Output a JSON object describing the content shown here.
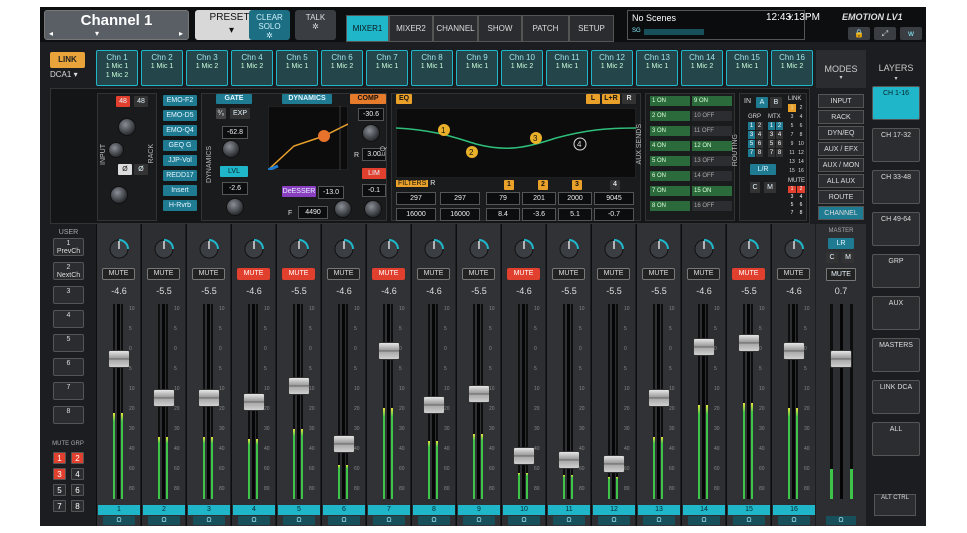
{
  "topbar": {
    "channel_title": "Channel 1",
    "prev_arrow": "◂",
    "next_arrow": "▸",
    "channel_menu": "▾",
    "preset_label": "PRESET*",
    "preset_menu": "▾",
    "clear_solo_label": "CLEAR SOLO",
    "talk_label": "TALK",
    "gear": "✲",
    "tabs": [
      "MIXER1",
      "MIXER2",
      "CHANNEL",
      "SHOW",
      "PATCH",
      "SETUP"
    ],
    "scenes_label": "No Scenes",
    "scenes_level": "SG",
    "time": "12:43:13PM",
    "logo": "EMOTION LV1",
    "icons": [
      "lock-icon",
      "fullscreen-icon",
      "waves-icon"
    ]
  },
  "link": {
    "label": "LINK",
    "dca_label": "DCA1 ▾"
  },
  "channels": [
    {
      "name": "Chn 1",
      "src": "1 Mic 1",
      "src2": "1 Mic 2"
    },
    {
      "name": "Chn 2",
      "src": "1 Mic 1"
    },
    {
      "name": "Chn 3",
      "src": "1 Mic 2"
    },
    {
      "name": "Chn 4",
      "src": "1 Mic 2"
    },
    {
      "name": "Chn 5",
      "src": "1 Mic 1"
    },
    {
      "name": "Chn 6",
      "src": "1 Mic 2"
    },
    {
      "name": "Chn 7",
      "src": "1 Mic 1"
    },
    {
      "name": "Chn 8",
      "src": "1 Mic 1"
    },
    {
      "name": "Chn 9",
      "src": "1 Mic 1"
    },
    {
      "name": "Chn 10",
      "src": "1 Mic 2"
    },
    {
      "name": "Chn 11",
      "src": "1 Mic 1"
    },
    {
      "name": "Chn 12",
      "src": "1 Mic 2"
    },
    {
      "name": "Chn 13",
      "src": "1 Mic 1"
    },
    {
      "name": "Chn 14",
      "src": "1 Mic 2"
    },
    {
      "name": "Chn 15",
      "src": "1 Mic 1"
    },
    {
      "name": "Chn 16",
      "src": "1 Mic 2"
    }
  ],
  "modes": {
    "label": "MODES",
    "arrow": "▾"
  },
  "layers": {
    "label": "LAYERS",
    "arrow": "▾",
    "items": [
      "CH 1-16",
      "CH 17-32",
      "CH 33-48",
      "CH 49-64",
      "GRP",
      "AUX",
      "MASTERS",
      "LINK DCA",
      "ALL"
    ],
    "alt_ctrl": "ALT CTRL"
  },
  "editor": {
    "input_label": "INPUT",
    "rack_label": "RACK",
    "phantom": "48",
    "phase": "Ø",
    "rack_items": [
      "EMO-F2",
      "EMO-D5",
      "EMO-Q4",
      "GEQ G",
      "JJP-Vol",
      "REDD17",
      "Insert",
      "H-Rvrb"
    ],
    "dynamics_label": "DYNAMICS",
    "gate_label": "GATE",
    "dynamics_head": "DYNAMICS",
    "comp_label": "COMP",
    "exp_label": "EXP",
    "gate_thresh": "-62.8",
    "lvl_label": "LVL",
    "lvl_value": "-2.6",
    "deesser_label": "DeESSER",
    "deesser_value": "-13.0",
    "deesser_f_label": "F",
    "deesser_freq": "4490",
    "comp_thresh": "-30.6",
    "comp_r_label": "R",
    "comp_ratio": "3.00",
    "lim_label": "LIM",
    "lim_value": "-0.1",
    "eq_label": "EQ",
    "eq_section_label": "EQ",
    "eq_l": "L",
    "eq_lr": "L+R",
    "eq_r": "R",
    "eq_bands": [
      "1",
      "2",
      "3",
      "4"
    ],
    "filters_label": "FILTERS",
    "filters_r": "R",
    "filter_vals": [
      "297",
      "297"
    ],
    "filter_vals2": [
      "16000",
      "16000"
    ],
    "eq_freqs": [
      "79",
      "201",
      "2000",
      "9045"
    ],
    "eq_gains": [
      "8.4",
      "-3.6",
      "5.1",
      "-0.7"
    ],
    "aux_label": "AUX SENDS",
    "aux_left": [
      "1 ON",
      "2 ON",
      "3 ON",
      "4 ON",
      "5 ON",
      "6 ON",
      "7 ON",
      "8 ON"
    ],
    "aux_right": [
      "9 ON",
      "10 OFF",
      "11 OFF",
      "12 ON",
      "13 OFF",
      "14 OFF",
      "15 ON",
      "16 OFF"
    ],
    "routing_label": "ROUTING",
    "routing_in": "IN",
    "routing_a": "A",
    "routing_b": "B",
    "grp_label": "GRP",
    "mtx_label": "MTX",
    "grp_nums": [
      "1",
      "2",
      "3",
      "4",
      "5",
      "6",
      "7",
      "8"
    ],
    "mtx_nums": [
      "1",
      "2",
      "3",
      "4",
      "5",
      "6",
      "7",
      "8"
    ],
    "lr_label": "L/R",
    "c_label": "C",
    "m_label": "M",
    "link_label": "LINK",
    "link_nums": [
      "1",
      "2",
      "3",
      "4",
      "5",
      "6",
      "7",
      "8",
      "9",
      "10",
      "11",
      "12",
      "13",
      "14",
      "15",
      "16"
    ],
    "mute_label": "MUTE",
    "mute_nums": [
      "1",
      "2",
      "3",
      "4",
      "5",
      "6",
      "7",
      "8"
    ]
  },
  "mode_buttons": [
    "INPUT",
    "RACK",
    "DYN/EQ",
    "AUX / EFX",
    "AUX / MON",
    "ALL AUX",
    "ROUTE",
    "CHANNEL"
  ],
  "user": {
    "label": "USER",
    "buttons": [
      {
        "n": "1",
        "t": "PrevCh"
      },
      {
        "n": "2",
        "t": "NextCh"
      },
      {
        "n": "3",
        "t": ""
      },
      {
        "n": "4",
        "t": ""
      },
      {
        "n": "5",
        "t": ""
      },
      {
        "n": "6",
        "t": ""
      },
      {
        "n": "7",
        "t": ""
      },
      {
        "n": "8",
        "t": ""
      }
    ],
    "mute_grp_label": "MUTE GRP",
    "mute_grp": [
      "1",
      "2",
      "3",
      "4",
      "5",
      "6",
      "7",
      "8"
    ]
  },
  "mixer": {
    "mute_label": "MUTE",
    "phones_icon": "Ω",
    "strips": [
      {
        "num": "1",
        "gain": "-4.6",
        "mute": false,
        "fader": 0.72
      },
      {
        "num": "2",
        "gain": "-5.5",
        "mute": false,
        "fader": 0.52
      },
      {
        "num": "3",
        "gain": "-5.5",
        "mute": false,
        "fader": 0.52
      },
      {
        "num": "4",
        "gain": "-4.6",
        "mute": true,
        "fader": 0.5
      },
      {
        "num": "5",
        "gain": "-5.5",
        "mute": true,
        "fader": 0.58
      },
      {
        "num": "6",
        "gain": "-4.6",
        "mute": false,
        "fader": 0.28
      },
      {
        "num": "7",
        "gain": "-4.6",
        "mute": true,
        "fader": 0.76
      },
      {
        "num": "8",
        "gain": "-4.6",
        "mute": false,
        "fader": 0.48
      },
      {
        "num": "9",
        "gain": "-5.5",
        "mute": false,
        "fader": 0.54
      },
      {
        "num": "10",
        "gain": "-4.6",
        "mute": true,
        "fader": 0.22
      },
      {
        "num": "11",
        "gain": "-5.5",
        "mute": false,
        "fader": 0.2
      },
      {
        "num": "12",
        "gain": "-5.5",
        "mute": false,
        "fader": 0.18
      },
      {
        "num": "13",
        "gain": "-5.5",
        "mute": false,
        "fader": 0.52
      },
      {
        "num": "14",
        "gain": "-4.6",
        "mute": false,
        "fader": 0.78
      },
      {
        "num": "15",
        "gain": "-5.5",
        "mute": true,
        "fader": 0.8
      },
      {
        "num": "16",
        "gain": "-4.6",
        "mute": false,
        "fader": 0.76
      }
    ],
    "scale": [
      "10",
      "5",
      "0",
      "5",
      "10",
      "20",
      "30",
      "40",
      "60",
      "80"
    ],
    "master": {
      "label": "MASTER",
      "lr": "LR",
      "c": "C",
      "m": "M",
      "mute": "MUTE",
      "gain": "0.7",
      "fader": 0.72
    }
  }
}
